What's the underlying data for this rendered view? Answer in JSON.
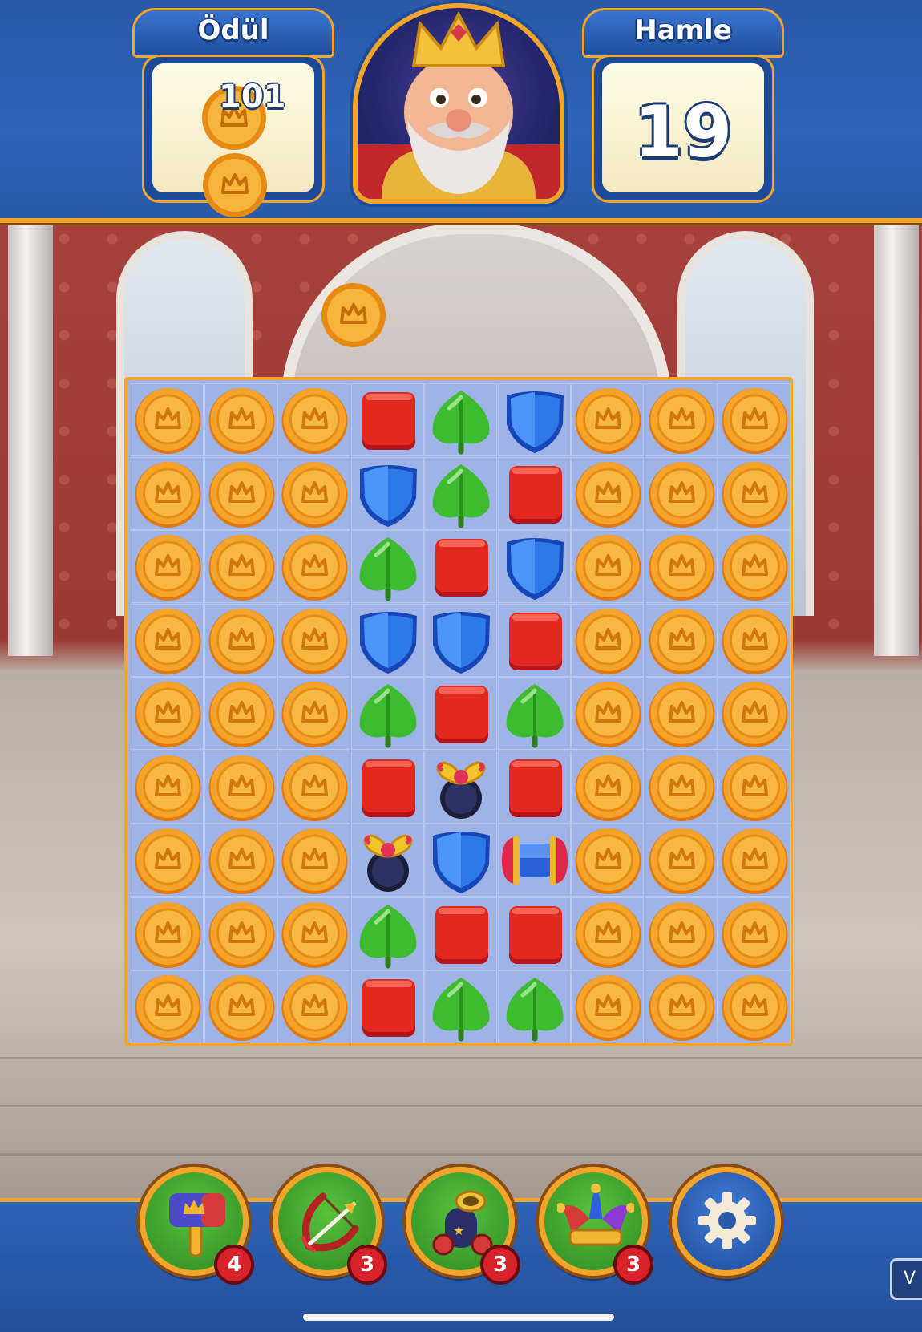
{
  "header": {
    "reward_label": "Ödül",
    "reward_value": "101",
    "moves_label": "Hamle",
    "moves_value": "19"
  },
  "board": {
    "rows": 9,
    "cols": 9,
    "grid": [
      [
        "coin",
        "coin",
        "coin",
        "red-book",
        "green-leaf",
        "blue-shield",
        "coin",
        "coin",
        "coin"
      ],
      [
        "coin",
        "coin",
        "coin",
        "blue-shield",
        "green-leaf",
        "red-book",
        "coin",
        "coin",
        "coin"
      ],
      [
        "coin",
        "coin",
        "coin",
        "green-leaf",
        "red-book",
        "blue-shield",
        "coin",
        "coin",
        "coin"
      ],
      [
        "coin",
        "coin",
        "coin",
        "blue-shield",
        "blue-shield",
        "red-book",
        "coin",
        "coin",
        "coin"
      ],
      [
        "coin",
        "coin",
        "coin",
        "green-leaf",
        "red-book",
        "green-leaf",
        "coin",
        "coin",
        "coin"
      ],
      [
        "coin",
        "coin",
        "coin",
        "red-book",
        "propeller",
        "red-book",
        "coin",
        "coin",
        "coin"
      ],
      [
        "coin",
        "coin",
        "coin",
        "propeller",
        "blue-shield",
        "rocket",
        "coin",
        "coin",
        "coin"
      ],
      [
        "coin",
        "coin",
        "coin",
        "green-leaf",
        "red-book",
        "red-book",
        "coin",
        "coin",
        "coin"
      ],
      [
        "coin",
        "coin",
        "coin",
        "red-book",
        "green-leaf",
        "green-leaf",
        "coin",
        "coin",
        "coin"
      ]
    ]
  },
  "boosters": [
    {
      "icon": "hammer-icon",
      "count": "4"
    },
    {
      "icon": "arrow-icon",
      "count": "3"
    },
    {
      "icon": "cannon-icon",
      "count": "3"
    },
    {
      "icon": "jester-hat-icon",
      "count": "3"
    }
  ],
  "side_chip": "V",
  "colors": {
    "header_blue": "#2d63b8",
    "gold_border": "#f2a52a",
    "board_bg": "#9fb3e6",
    "badge_red": "#d8232a"
  }
}
